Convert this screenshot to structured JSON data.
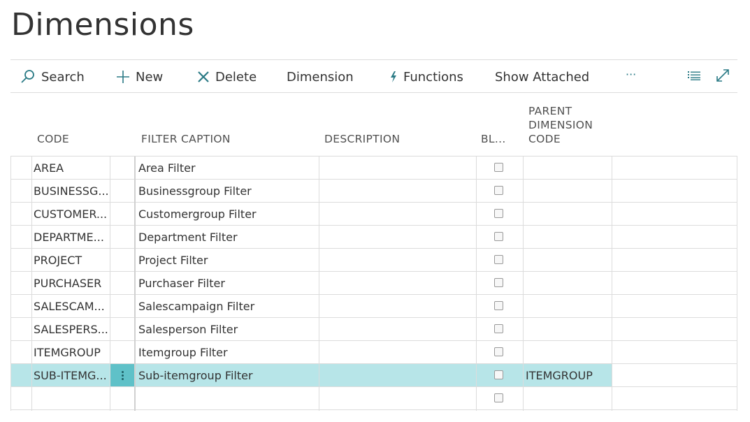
{
  "page": {
    "title": "Dimensions"
  },
  "actions": {
    "search": "Search",
    "new": "New",
    "delete": "Delete",
    "dimension": "Dimension",
    "functions": "Functions",
    "show_attached": "Show Attached",
    "more": "···"
  },
  "columns": {
    "code": "CODE",
    "filter_caption": "FILTER CAPTION",
    "description": "DESCRIPTION",
    "blocked": "BL...",
    "parent_line1": "PARENT",
    "parent_line2": "DIMENSION",
    "parent_line3": "CODE"
  },
  "rows": [
    {
      "code": "AREA",
      "caption": "Area Filter",
      "description": "",
      "parent": ""
    },
    {
      "code": "BUSINESSG...",
      "caption": "Businessgroup Filter",
      "description": "",
      "parent": ""
    },
    {
      "code": "CUSTOMER...",
      "caption": "Customergroup Filter",
      "description": "",
      "parent": ""
    },
    {
      "code": "DEPARTME...",
      "caption": "Department Filter",
      "description": "",
      "parent": ""
    },
    {
      "code": "PROJECT",
      "caption": "Project Filter",
      "description": "",
      "parent": ""
    },
    {
      "code": "PURCHASER",
      "caption": "Purchaser Filter",
      "description": "",
      "parent": ""
    },
    {
      "code": "SALESCAM...",
      "caption": "Salescampaign Filter",
      "description": "",
      "parent": ""
    },
    {
      "code": "SALESPERS...",
      "caption": "Salesperson Filter",
      "description": "",
      "parent": ""
    },
    {
      "code": "ITEMGROUP",
      "caption": "Itemgroup Filter",
      "description": "",
      "parent": ""
    },
    {
      "code": "SUB-ITEMG...",
      "caption": "Sub-itemgroup Filter",
      "description": "",
      "parent": "ITEMGROUP"
    },
    {
      "code": "",
      "caption": "",
      "description": "",
      "parent": ""
    }
  ],
  "colors": {
    "selected_row": "#b7e5e8",
    "row_action": "#5fc1c8",
    "accent": "#2a7a85"
  }
}
